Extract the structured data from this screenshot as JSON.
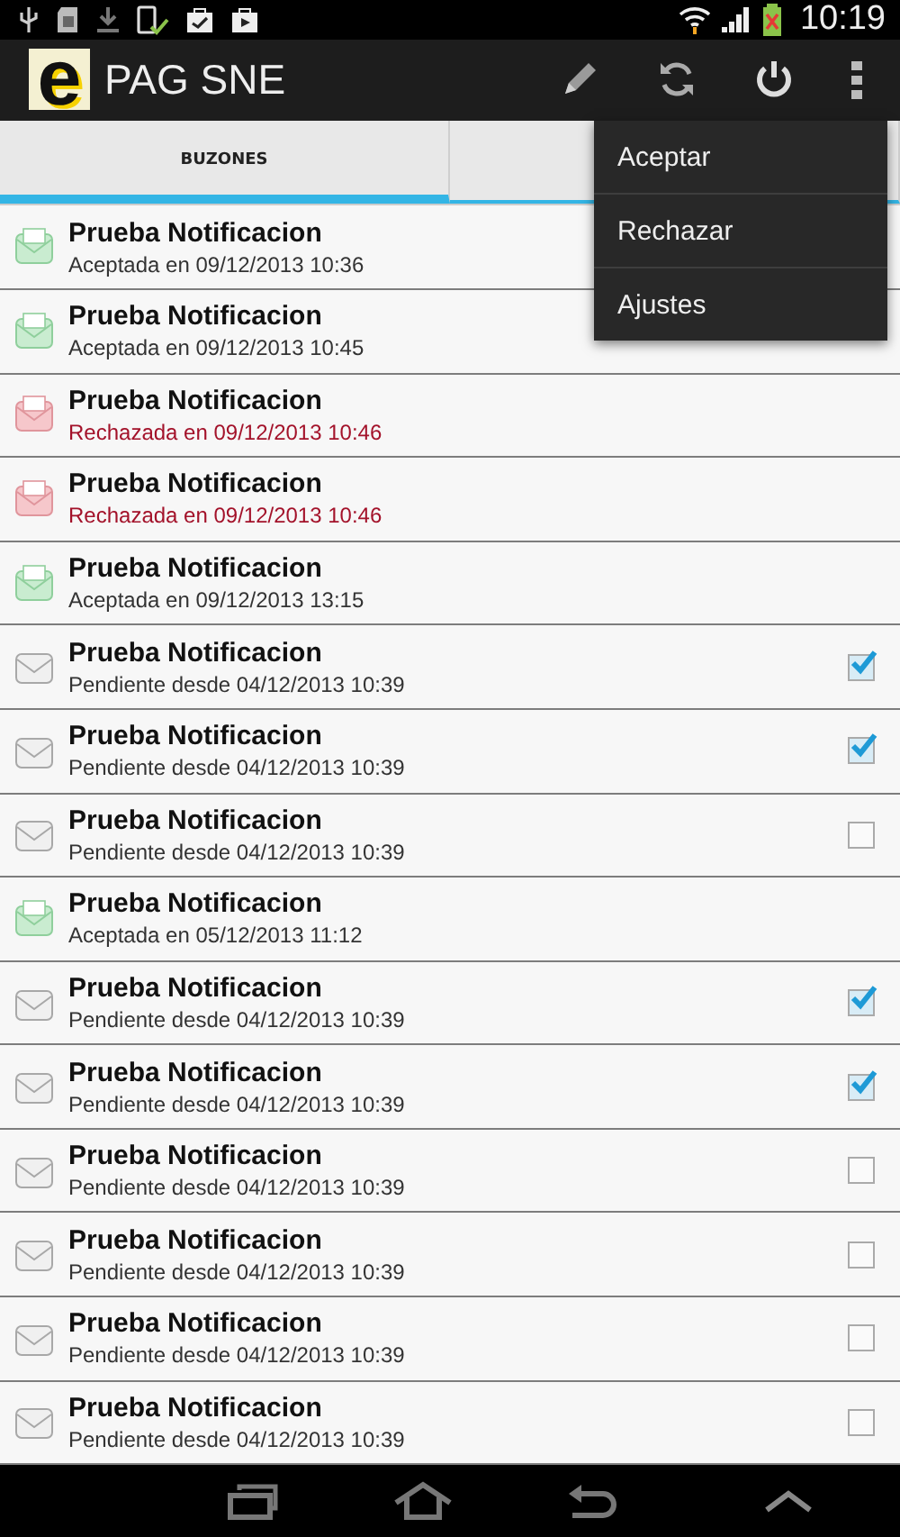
{
  "status_bar": {
    "time": "10:19"
  },
  "action_bar": {
    "title": "PAG SNE",
    "logo_letter": "e"
  },
  "tabs": [
    {
      "label": "BUZONES",
      "selected": true
    },
    {
      "selected": false
    }
  ],
  "menu": {
    "items": [
      "Aceptar",
      "Rechazar",
      "Ajustes"
    ]
  },
  "notifications": [
    {
      "title": "Prueba Notificacion",
      "kind": "accepted",
      "detail": "Aceptada en 09/12/2013 10:36"
    },
    {
      "title": "Prueba Notificacion",
      "kind": "accepted",
      "detail": "Aceptada en 09/12/2013 10:45"
    },
    {
      "title": "Prueba Notificacion",
      "kind": "rejected",
      "detail": "Rechazada en 09/12/2013 10:46"
    },
    {
      "title": "Prueba Notificacion",
      "kind": "rejected",
      "detail": "Rechazada en 09/12/2013 10:46"
    },
    {
      "title": "Prueba Notificacion",
      "kind": "accepted",
      "detail": "Aceptada en 09/12/2013 13:15"
    },
    {
      "title": "Prueba Notificacion",
      "kind": "pending",
      "detail": "Pendiente desde 04/12/2013 10:39",
      "checked": true
    },
    {
      "title": "Prueba Notificacion",
      "kind": "pending",
      "detail": "Pendiente desde 04/12/2013 10:39",
      "checked": true
    },
    {
      "title": "Prueba Notificacion",
      "kind": "pending",
      "detail": "Pendiente desde 04/12/2013 10:39",
      "checked": false
    },
    {
      "title": "Prueba Notificacion",
      "kind": "accepted",
      "detail": "Aceptada en 05/12/2013 11:12"
    },
    {
      "title": "Prueba Notificacion",
      "kind": "pending",
      "detail": "Pendiente desde 04/12/2013 10:39",
      "checked": true
    },
    {
      "title": "Prueba Notificacion",
      "kind": "pending",
      "detail": "Pendiente desde 04/12/2013 10:39",
      "checked": true
    },
    {
      "title": "Prueba Notificacion",
      "kind": "pending",
      "detail": "Pendiente desde 04/12/2013 10:39",
      "checked": false
    },
    {
      "title": "Prueba Notificacion",
      "kind": "pending",
      "detail": "Pendiente desde 04/12/2013 10:39",
      "checked": false
    },
    {
      "title": "Prueba Notificacion",
      "kind": "pending",
      "detail": "Pendiente desde 04/12/2013 10:39",
      "checked": false
    },
    {
      "title": "Prueba Notificacion",
      "kind": "pending",
      "detail": "Pendiente desde 04/12/2013 10:39",
      "checked": false
    }
  ]
}
